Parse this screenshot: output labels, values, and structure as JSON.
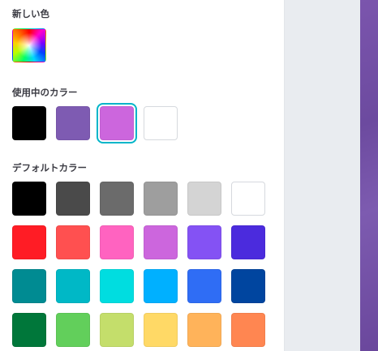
{
  "sections": {
    "new_color": {
      "title": "新しい色"
    },
    "in_use": {
      "title": "使用中のカラー"
    },
    "default": {
      "title": "デフォルトカラー"
    }
  },
  "new_color_swatch": {
    "icon": "rainbow-color-picker-icon"
  },
  "in_use_colors": [
    "#000000",
    "#7e5bb2",
    "#cc66dd",
    "#ffffff"
  ],
  "in_use_selected": "#cc66dd",
  "default_colors": [
    [
      "#000000",
      "#4a4a4a",
      "#6b6b6b",
      "#9e9e9e",
      "#d4d4d4",
      "#ffffff"
    ],
    [
      "#ff1c25",
      "#ff5050",
      "#ff63c0",
      "#cc66dd",
      "#8452f4",
      "#4b2bdd"
    ],
    [
      "#008b92",
      "#00b8c6",
      "#00dde0",
      "#00b0ff",
      "#2f6df5",
      "#00459f"
    ],
    [
      "#00773a",
      "#62cf5b",
      "#c4de6b",
      "#ffd966",
      "#ffb35a",
      "#ff8651"
    ]
  ]
}
